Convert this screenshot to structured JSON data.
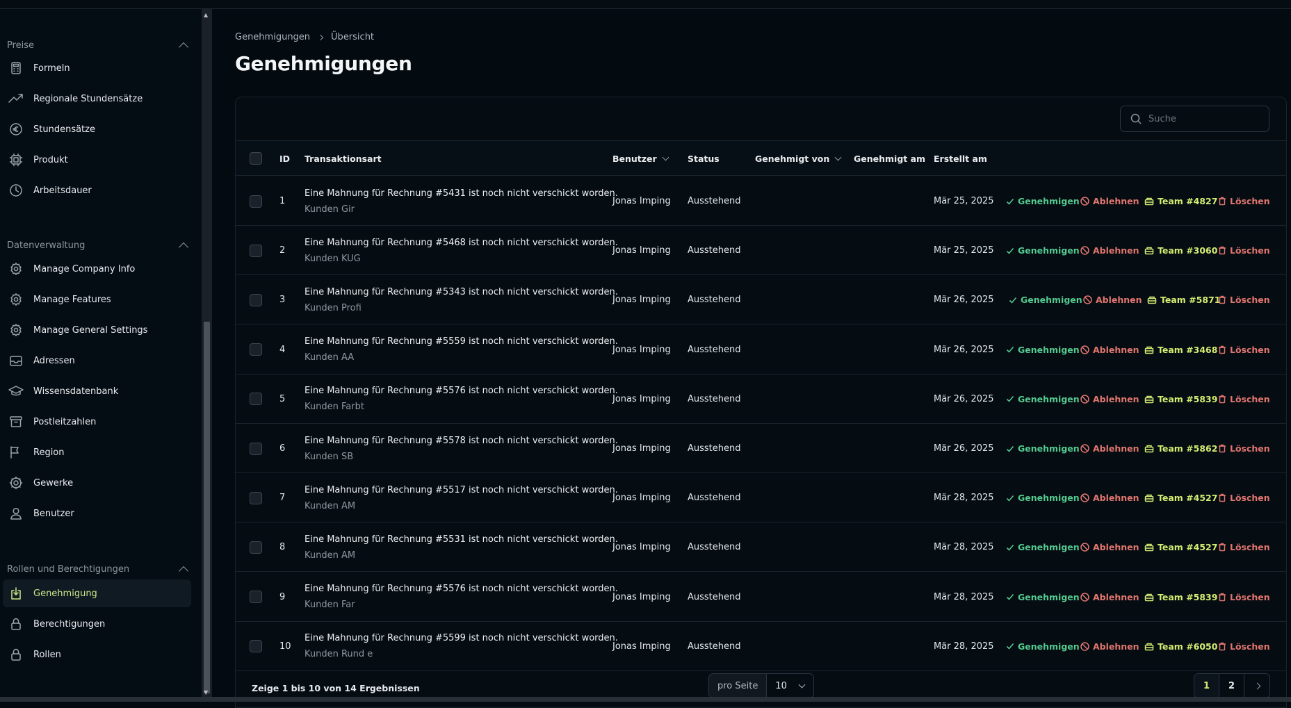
{
  "sidebar": {
    "sections": [
      {
        "title": "Preise",
        "items": [
          {
            "label": "Formeln",
            "icon": "calculator-icon"
          },
          {
            "label": "Regionale Stundensätze",
            "icon": "trending-up-icon"
          },
          {
            "label": "Stundensätze",
            "icon": "euro-icon"
          },
          {
            "label": "Produkt",
            "icon": "chip-icon"
          },
          {
            "label": "Arbeitsdauer",
            "icon": "clock-icon"
          }
        ]
      },
      {
        "title": "Datenverwaltung",
        "items": [
          {
            "label": "Manage Company Info",
            "icon": "gear-icon"
          },
          {
            "label": "Manage Features",
            "icon": "gear-icon"
          },
          {
            "label": "Manage General Settings",
            "icon": "gear-icon"
          },
          {
            "label": "Adressen",
            "icon": "inbox-icon"
          },
          {
            "label": "Wissensdatenbank",
            "icon": "graduation-cap-icon"
          },
          {
            "label": "Postleitzahlen",
            "icon": "archive-icon"
          },
          {
            "label": "Region",
            "icon": "flag-icon"
          },
          {
            "label": "Gewerke",
            "icon": "cog-wheel-icon"
          },
          {
            "label": "Benutzer",
            "icon": "user-icon"
          }
        ]
      },
      {
        "title": "Rollen und Berechtigungen",
        "items": [
          {
            "label": "Genehmigung",
            "icon": "download-tray-icon",
            "active": true
          },
          {
            "label": "Berechtigungen",
            "icon": "lock-icon"
          },
          {
            "label": "Rollen",
            "icon": "lock-icon"
          }
        ]
      }
    ]
  },
  "breadcrumb": {
    "parent": "Genehmigungen",
    "current": "Übersicht"
  },
  "page_title": "Genehmigungen",
  "search": {
    "placeholder": "Suche"
  },
  "table": {
    "headers": {
      "id": "ID",
      "type": "Transaktionsart",
      "user": "Benutzer",
      "status": "Status",
      "approved_by": "Genehmigt von",
      "approved_at": "Genehmigt am",
      "created_at": "Erstellt am"
    },
    "actions": {
      "approve": "Genehmigen",
      "reject": "Ablehnen",
      "delete": "Löschen"
    },
    "rows": [
      {
        "id": "1",
        "title": "Eine Mahnung für Rechnung #5431 ist noch nicht verschickt worden.",
        "sub": "Kunden Gir",
        "user": "Jonas Imping",
        "status": "Ausstehend",
        "created": "Mär 25, 2025",
        "team": "Team #4827"
      },
      {
        "id": "2",
        "title": "Eine Mahnung für Rechnung #5468 ist noch nicht verschickt worden.",
        "sub": "Kunden KUG",
        "user": "Jonas Imping",
        "status": "Ausstehend",
        "created": "Mär 25, 2025",
        "team": "Team #3060"
      },
      {
        "id": "3",
        "title": "Eine Mahnung für Rechnung #5343 ist noch nicht verschickt worden.",
        "sub": "Kunden Profi",
        "user": "Jonas Imping",
        "status": "Ausstehend",
        "created": "Mär 26, 2025",
        "team": "Team #5871"
      },
      {
        "id": "4",
        "title": "Eine Mahnung für Rechnung #5559 ist noch nicht verschickt worden.",
        "sub": "Kunden AA",
        "user": "Jonas Imping",
        "status": "Ausstehend",
        "created": "Mär 26, 2025",
        "team": "Team #3468"
      },
      {
        "id": "5",
        "title": "Eine Mahnung für Rechnung #5576 ist noch nicht verschickt worden.",
        "sub": "Kunden Farbt",
        "user": "Jonas Imping",
        "status": "Ausstehend",
        "created": "Mär 26, 2025",
        "team": "Team #5839"
      },
      {
        "id": "6",
        "title": "Eine Mahnung für Rechnung #5578 ist noch nicht verschickt worden.",
        "sub": "Kunden SB",
        "user": "Jonas Imping",
        "status": "Ausstehend",
        "created": "Mär 26, 2025",
        "team": "Team #5862"
      },
      {
        "id": "7",
        "title": "Eine Mahnung für Rechnung #5517 ist noch nicht verschickt worden.",
        "sub": "Kunden AM",
        "user": "Jonas Imping",
        "status": "Ausstehend",
        "created": "Mär 28, 2025",
        "team": "Team #4527"
      },
      {
        "id": "8",
        "title": "Eine Mahnung für Rechnung #5531 ist noch nicht verschickt worden.",
        "sub": "Kunden AM",
        "user": "Jonas Imping",
        "status": "Ausstehend",
        "created": "Mär 28, 2025",
        "team": "Team #4527"
      },
      {
        "id": "9",
        "title": "Eine Mahnung für Rechnung #5576 ist noch nicht verschickt worden.",
        "sub": "Kunden Far",
        "user": "Jonas Imping",
        "status": "Ausstehend",
        "created": "Mär 28, 2025",
        "team": "Team #5839"
      },
      {
        "id": "10",
        "title": "Eine Mahnung für Rechnung #5599 ist noch nicht verschickt worden.",
        "sub": "Kunden Rund e",
        "user": "Jonas Imping",
        "status": "Ausstehend",
        "created": "Mär 28, 2025",
        "team": "Team #6050"
      }
    ]
  },
  "footer": {
    "summary": "Zeige 1 bis 10 von 14 Ergebnissen",
    "per_page_label": "pro Seite",
    "per_page_value": "10",
    "pages": [
      "1",
      "2"
    ],
    "current_page": "1"
  },
  "colors": {
    "background": "#030a10",
    "accent": "#d4ec72",
    "approve": "#54c98f",
    "reject": "#e2766f"
  }
}
